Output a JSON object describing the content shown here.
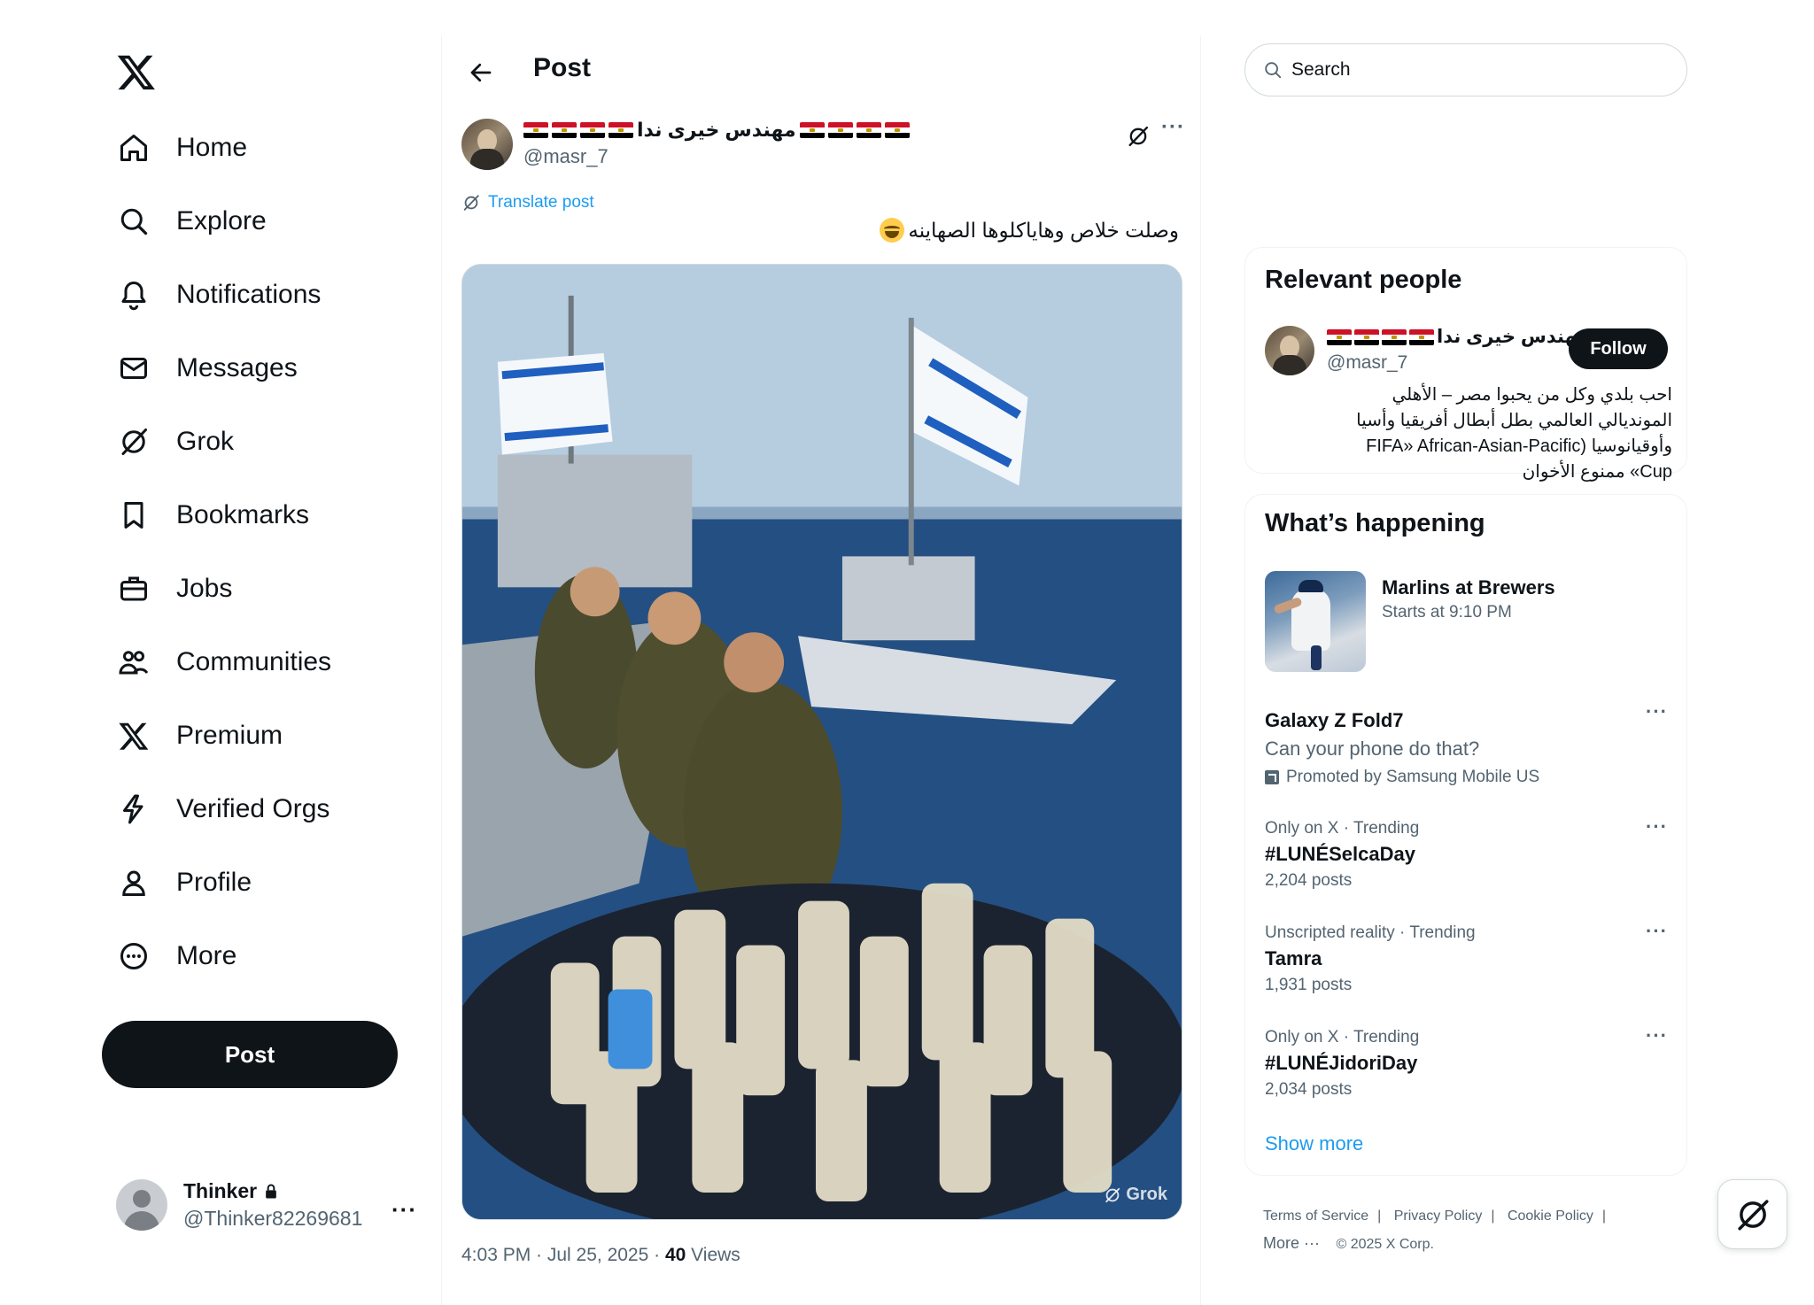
{
  "nav": {
    "logo": "x-logo-icon",
    "items": [
      {
        "label": "Home",
        "icon": "home-icon"
      },
      {
        "label": "Explore",
        "icon": "search-icon"
      },
      {
        "label": "Notifications",
        "icon": "bell-icon"
      },
      {
        "label": "Messages",
        "icon": "envelope-icon"
      },
      {
        "label": "Grok",
        "icon": "grok-icon"
      },
      {
        "label": "Bookmarks",
        "icon": "bookmark-icon"
      },
      {
        "label": "Jobs",
        "icon": "briefcase-icon"
      },
      {
        "label": "Communities",
        "icon": "people-icon"
      },
      {
        "label": "Premium",
        "icon": "x-logo-icon"
      },
      {
        "label": "Verified Orgs",
        "icon": "lightning-icon"
      },
      {
        "label": "Profile",
        "icon": "person-icon"
      },
      {
        "label": "More",
        "icon": "more-circle-icon"
      }
    ],
    "post_label": "Post"
  },
  "account": {
    "name": "Thinker",
    "handle": "@Thinker82269681",
    "more": "···"
  },
  "post": {
    "header_title": "Post",
    "author_name": "مهندس خيرى ندا",
    "author_handle": "@masr_7",
    "translate_label": "Translate post",
    "text": "وصلت خلاص وهاياكلوها الصهاينه",
    "image_watermark": "Grok",
    "time": "4:03 PM · Jul 25, 2025 · ",
    "views_count": "40",
    "views_label": " Views"
  },
  "search": {
    "placeholder": "Search"
  },
  "relevant_people": {
    "title": "Relevant people",
    "name": "مهندس خيرى ندا...",
    "handle": "@masr_7",
    "follow_label": "Follow",
    "bio": "احب بلدي وكل من يحبوا مصر – الأهلي المونديالي العالمي بطل أبطال أفريقيا وأسيا وأوقيانوسيا (FIFA» African-Asian-Pacific Cup» ممنوع الأخوان"
  },
  "happening": {
    "title": "What’s happening",
    "event": {
      "title": "Marlins at Brewers",
      "sub": "Starts at 9:10 PM"
    },
    "promo": {
      "title": "Galaxy Z Fold7",
      "line": "Can your phone do that?",
      "promoted": "Promoted by Samsung Mobile US"
    },
    "trends": [
      {
        "context": "Only on X · Trending",
        "name": "#LUNÉSelcaDay",
        "posts": "2,204 posts"
      },
      {
        "context": "Unscripted reality · Trending",
        "name": "Tamra",
        "posts": "1,931 posts"
      },
      {
        "context": "Only on X · Trending",
        "name": "#LUNÉJidoriDay",
        "posts": "2,034 posts"
      }
    ],
    "show_more": "Show more"
  },
  "footer": {
    "terms": "Terms of Service",
    "privacy": "Privacy Policy",
    "cookie": "Cookie Policy",
    "more": "More ···",
    "copyright": "© 2025 X Corp."
  },
  "colors": {
    "text": "#0f1419",
    "muted": "#536471",
    "link": "#1d9bf0",
    "border": "#eff3f4",
    "button": "#0f1419"
  }
}
